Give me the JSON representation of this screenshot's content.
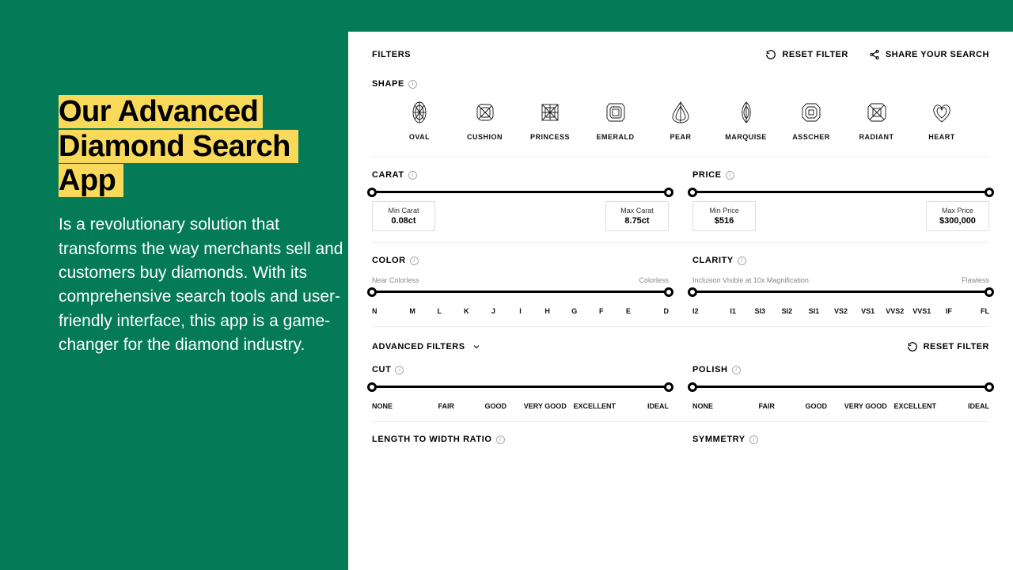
{
  "promo": {
    "title_line1": "Our Advanced",
    "title_line2": "Diamond Search App",
    "body": "Is a revolutionary solution that transforms the way merchants sell and customers buy diamonds. With its comprehensive search tools and user-friendly interface, this app is a game-changer for the diamond industry."
  },
  "header": {
    "filters": "FILTERS",
    "reset": "RESET FILTER",
    "share": "SHARE YOUR SEARCH"
  },
  "sections": {
    "shape": "SHAPE",
    "carat": "CARAT",
    "price": "PRICE",
    "color": "COLOR",
    "clarity": "CLARITY",
    "advanced": "ADVANCED FILTERS",
    "cut": "CUT",
    "polish": "POLISH",
    "ltw": "LENGTH TO WIDTH RATIO",
    "symmetry": "SYMMETRY"
  },
  "shapes": [
    "OVAL",
    "CUSHION",
    "PRINCESS",
    "EMERALD",
    "PEAR",
    "MARQUISE",
    "ASSCHER",
    "RADIANT",
    "HEART"
  ],
  "carat": {
    "min_label": "Min Carat",
    "min_value": "0.08ct",
    "max_label": "Max Carat",
    "max_value": "8.75ct"
  },
  "price": {
    "min_label": "Min Price",
    "min_value": "$516",
    "max_label": "Max Price",
    "max_value": "$300,000"
  },
  "color": {
    "left_note": "Near Colorless",
    "right_note": "Colorless",
    "ticks": [
      "N",
      "M",
      "L",
      "K",
      "J",
      "I",
      "H",
      "G",
      "F",
      "E",
      "D"
    ]
  },
  "clarity": {
    "left_note": "Inclusion Visible at 10x Magnification",
    "right_note": "Flawless",
    "ticks": [
      "I2",
      "I1",
      "SI3",
      "SI2",
      "SI1",
      "VS2",
      "VS1",
      "VVS2",
      "VVS1",
      "IF",
      "FL"
    ]
  },
  "quality_ticks": [
    "NONE",
    "FAIR",
    "GOOD",
    "VERY GOOD",
    "EXCELLENT",
    "IDEAL"
  ]
}
